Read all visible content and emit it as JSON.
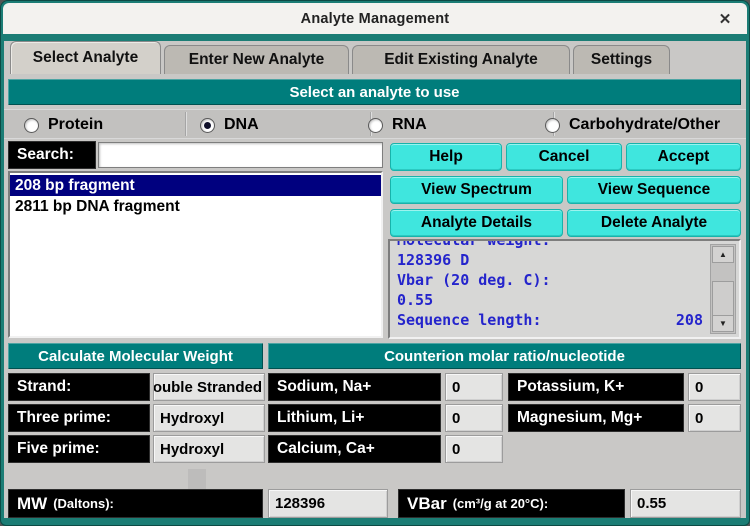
{
  "window": {
    "title": "Analyte Management"
  },
  "icons": {
    "close": "✕",
    "scroll_up": "▲",
    "scroll_down": "▼"
  },
  "colors": {
    "frame_teal": "#1b7d75",
    "header_teal": "#007d7c",
    "button_cyan": "#3fe6de",
    "selection_navy": "#00007f",
    "label_black": "#000000",
    "info_text_blue": "#2424cc"
  },
  "tabs": [
    {
      "label": "Select Analyte",
      "active": true
    },
    {
      "label": "Enter New Analyte",
      "active": false
    },
    {
      "label": "Edit Existing Analyte",
      "active": false
    },
    {
      "label": "Settings",
      "active": false
    }
  ],
  "banner": "Select an analyte to use",
  "analyte_types": [
    {
      "label": "Protein",
      "selected": false
    },
    {
      "label": "DNA",
      "selected": true
    },
    {
      "label": "RNA",
      "selected": false
    },
    {
      "label": "Carbohydrate/Other",
      "selected": false
    }
  ],
  "search": {
    "label": "Search:",
    "value": "",
    "placeholder": ""
  },
  "analyte_list": [
    {
      "label": "208 bp fragment",
      "selected": true
    },
    {
      "label": "2811 bp DNA fragment",
      "selected": false
    }
  ],
  "buttons": {
    "help": "Help",
    "cancel": "Cancel",
    "accept": "Accept",
    "view_spectrum": "View Spectrum",
    "view_sequence": "View Sequence",
    "analyte_details": "Analyte Details",
    "delete_analyte": "Delete Analyte"
  },
  "details_panel": {
    "lines": [
      "Molecular weight:",
      "128396 D",
      "Vbar (20 deg. C):",
      "0.55"
    ],
    "last_line_label": "Sequence length:",
    "last_line_value": "208"
  },
  "mw_section": {
    "header": "Calculate Molecular Weight",
    "rows": [
      {
        "label": "Strand:",
        "value": "Double Stranded"
      },
      {
        "label": "Three prime:",
        "value": "Hydroxyl"
      },
      {
        "label": "Five prime:",
        "value": "Hydroxyl"
      }
    ]
  },
  "counterion_section": {
    "header": "Counterion molar ratio/nucleotide",
    "left_column": [
      {
        "label": "Sodium, Na+",
        "value": "0"
      },
      {
        "label": "Lithium, Li+",
        "value": "0"
      },
      {
        "label": "Calcium, Ca+",
        "value": "0"
      }
    ],
    "right_column": [
      {
        "label": "Potassium, K+",
        "value": "0"
      },
      {
        "label": "Magnesium, Mg+",
        "value": "0"
      }
    ]
  },
  "footer": {
    "mw_label_main": "MW",
    "mw_label_sub": "(Daltons):",
    "mw_value": "128396",
    "vbar_label_main": "VBar",
    "vbar_label_sub": "(cm³/g at 20°C):",
    "vbar_value": "0.55"
  }
}
